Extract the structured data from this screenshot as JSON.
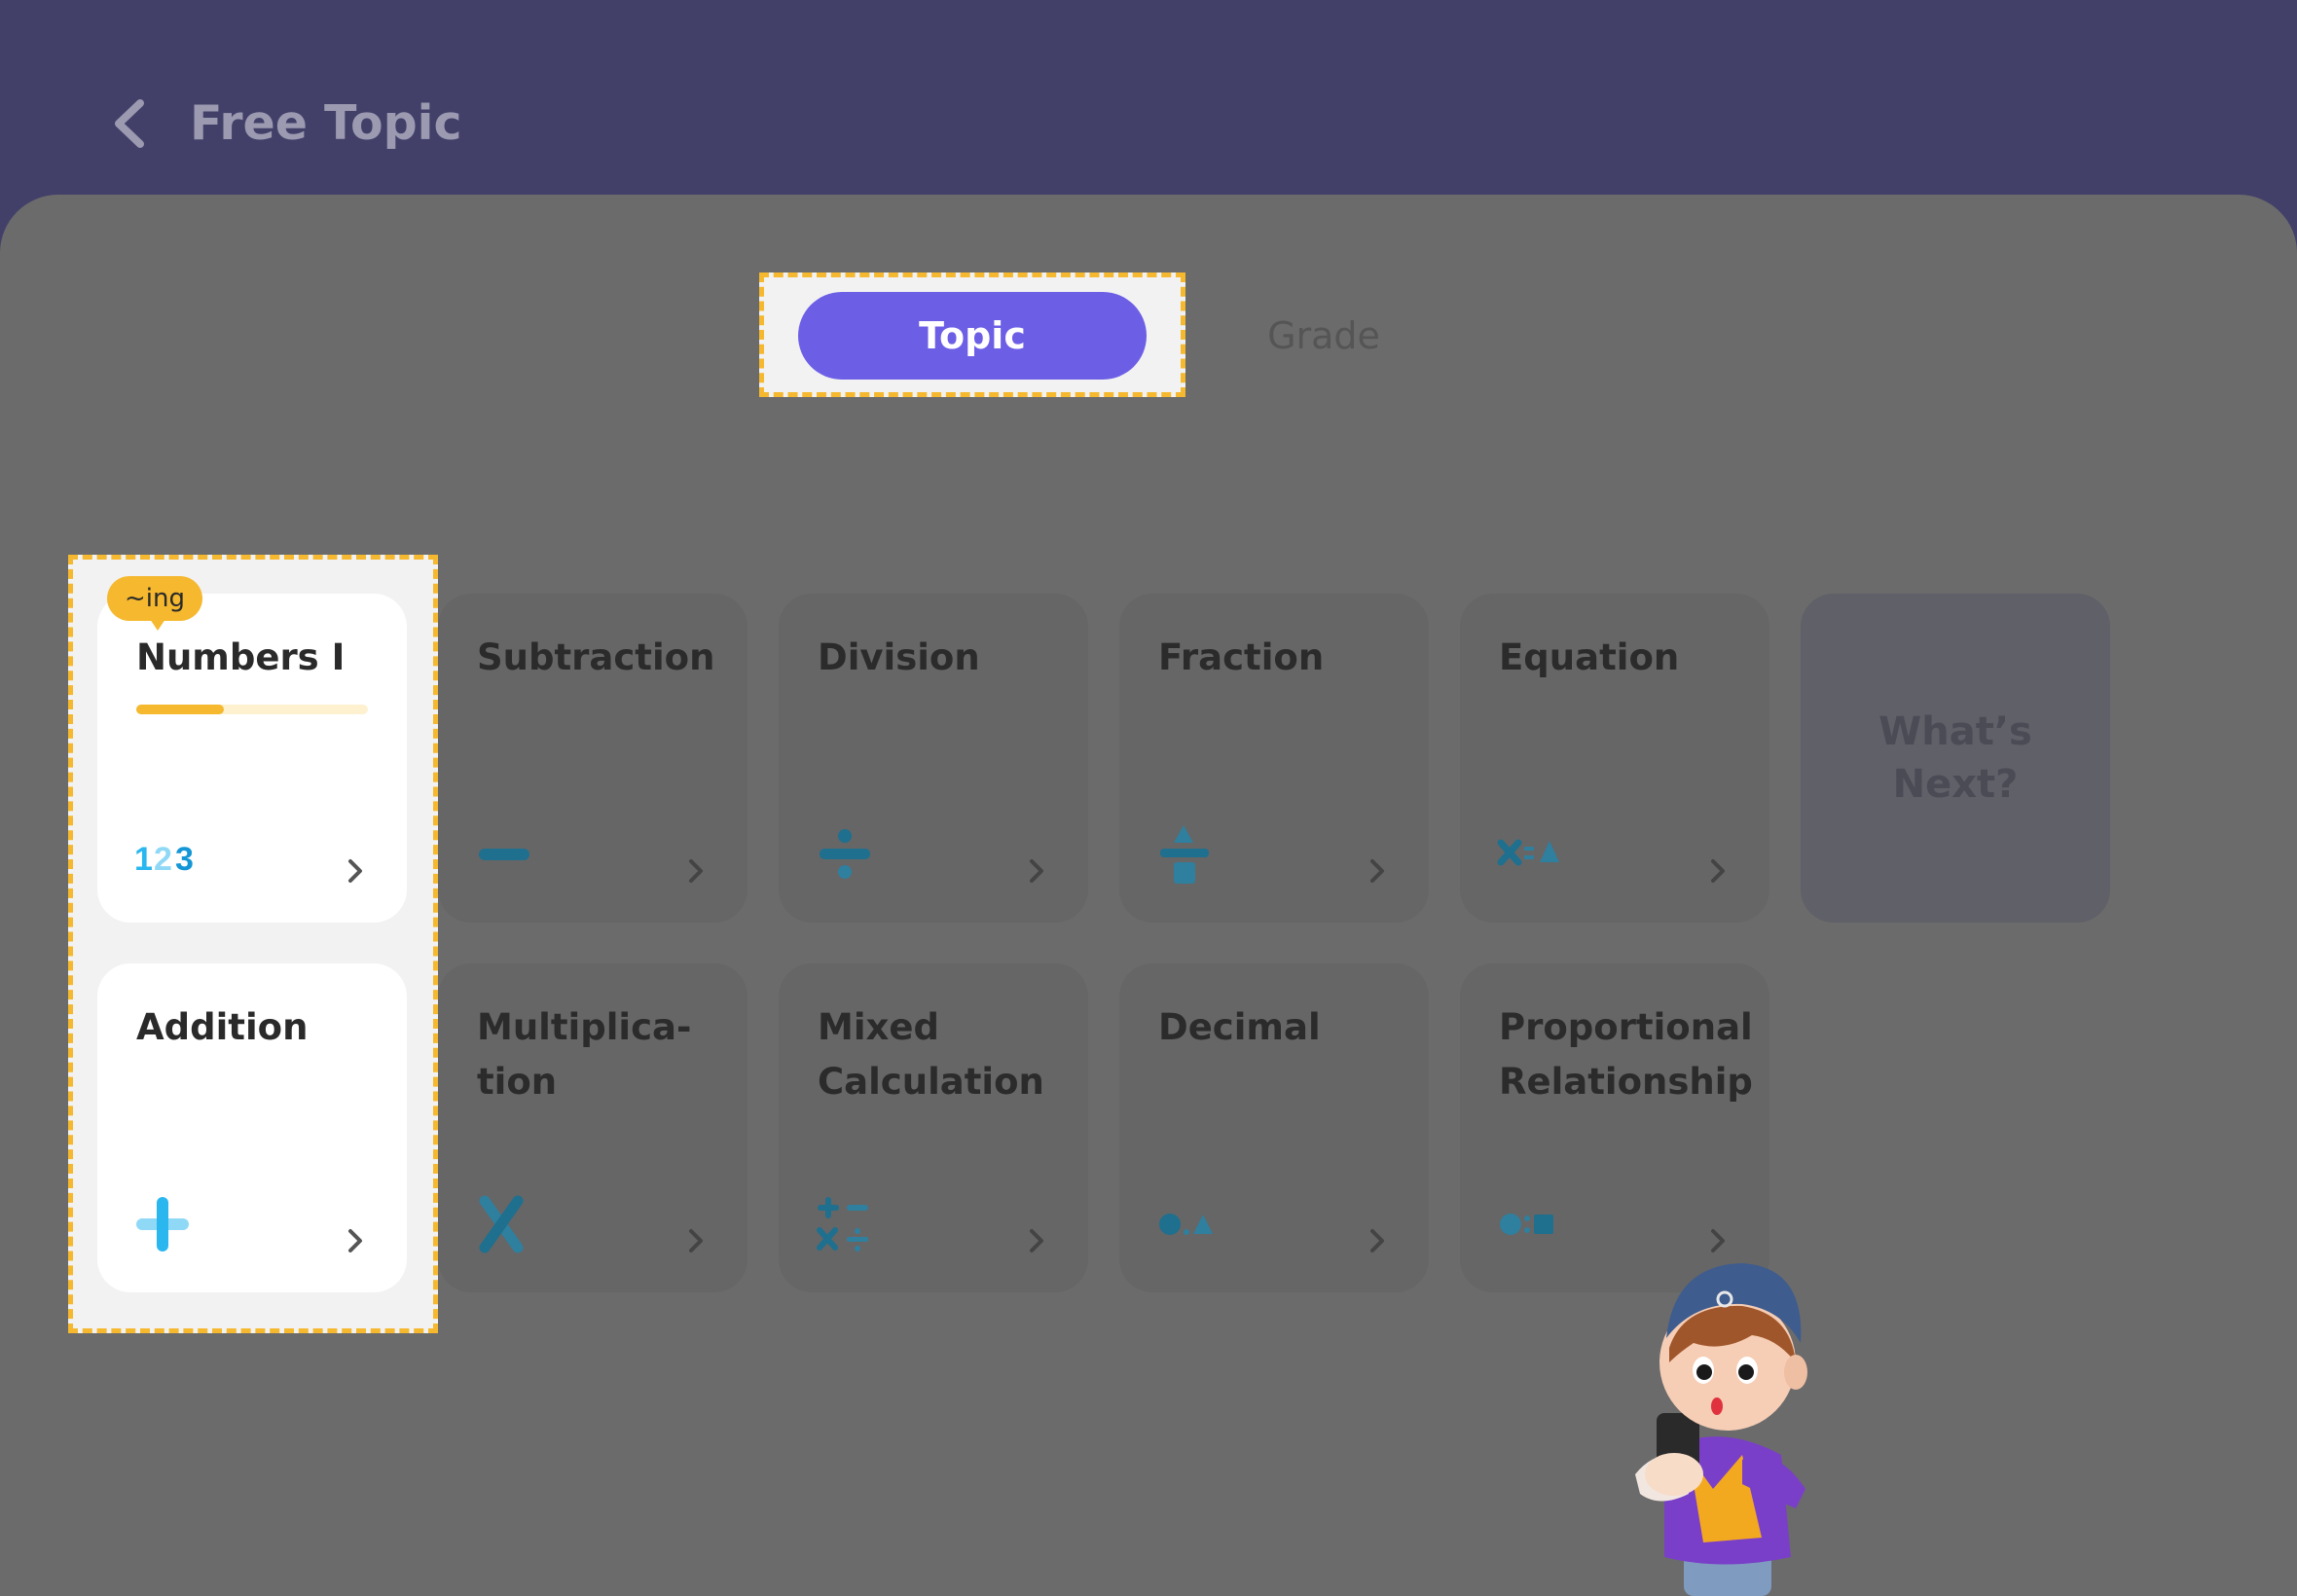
{
  "header": {
    "title": "Free Topic"
  },
  "tabs": {
    "topic": "Topic",
    "grade": "Grade"
  },
  "cards": [
    {
      "label": "Numbers I",
      "icon": "numbers-123-icon",
      "badge": "~ing",
      "progress": 0.38
    },
    {
      "label": "Subtraction",
      "icon": "minus-icon"
    },
    {
      "label": "Division",
      "icon": "divide-icon"
    },
    {
      "label": "Fraction",
      "icon": "fraction-icon"
    },
    {
      "label": "Equation",
      "icon": "equation-icon"
    },
    {
      "label": "What’s Next?"
    },
    {
      "label": "Addition",
      "icon": "plus-icon"
    },
    {
      "label": "Multiplica-tion",
      "label_line1": "Multiplica-",
      "label_line2": "tion",
      "icon": "multiply-icon"
    },
    {
      "label": "Mixed Calculation",
      "label_line1": "Mixed",
      "label_line2": "Calculation",
      "icon": "mixed-operations-icon"
    },
    {
      "label": "Decimal",
      "icon": "decimal-icon"
    },
    {
      "label": "Proportional Relationship",
      "label_line1": "Proportional",
      "label_line2": "Relationship",
      "icon": "ratio-icon"
    }
  ],
  "colors": {
    "header_bg": "#424069",
    "overlay_bg": "#6b6b6b",
    "accent_purple": "#6c5fe6",
    "highlight_yellow": "#f5b82e",
    "icon_blue": "#2ab7ef"
  }
}
